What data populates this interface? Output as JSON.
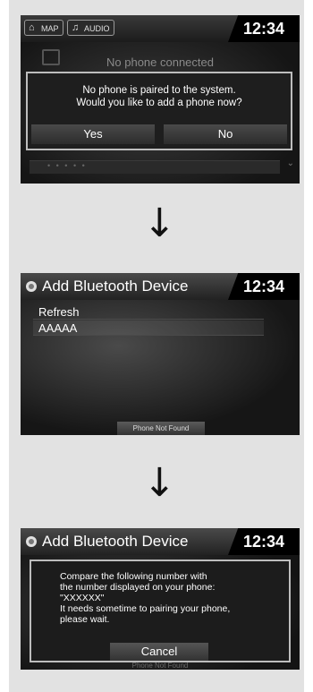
{
  "screen1": {
    "map_label": "MAP",
    "audio_label": "AUDIO",
    "time": "12:34",
    "status": "No phone connected",
    "dialog": {
      "line1": "No phone is paired to the system.",
      "line2": "Would you like to add a phone now?",
      "yes_label": "Yes",
      "no_label": "No"
    }
  },
  "screen2": {
    "title": "Add Bluetooth Device",
    "time": "12:34",
    "items": [
      "Refresh",
      "AAAAA"
    ],
    "footer_button": "Phone Not Found"
  },
  "screen3": {
    "title": "Add Bluetooth Device",
    "time": "12:34",
    "message_lines": [
      "Compare the following number with",
      "the number displayed on your phone:",
      "\"XXXXXX\"",
      "It needs sometime to pairing your phone,",
      "please wait."
    ],
    "cancel_label": "Cancel",
    "footer_button": "Phone Not Found"
  },
  "arrows": [
    "↓",
    "↓"
  ]
}
